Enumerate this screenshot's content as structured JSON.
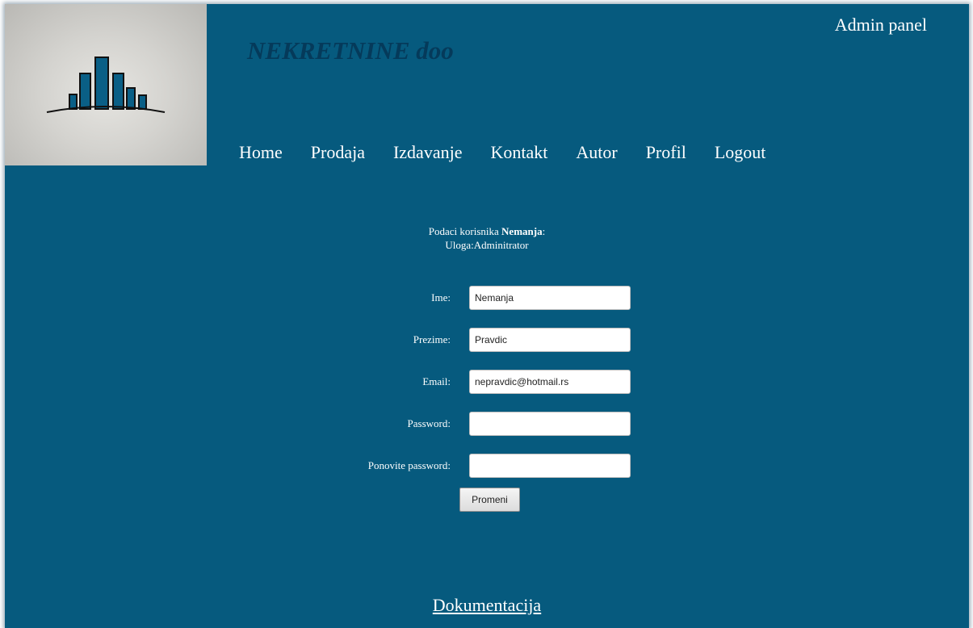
{
  "header": {
    "company_name": "NEKRETNINE doo",
    "admin_panel_label": "Admin panel"
  },
  "nav": {
    "items": [
      {
        "label": "Home"
      },
      {
        "label": "Prodaja"
      },
      {
        "label": "Izdavanje"
      },
      {
        "label": "Kontakt"
      },
      {
        "label": "Autor"
      },
      {
        "label": "Profil"
      },
      {
        "label": "Logout"
      }
    ]
  },
  "user_info": {
    "prefix": "Podaci korisnika ",
    "username": "Nemanja",
    "suffix": ":",
    "role_line": "Uloga:Adminitrator"
  },
  "form": {
    "fields": [
      {
        "label": "Ime:",
        "value": "Nemanja",
        "type": "text"
      },
      {
        "label": "Prezime:",
        "value": "Pravdic",
        "type": "text"
      },
      {
        "label": "Email:",
        "value": "nepravdic@hotmail.rs",
        "type": "text"
      },
      {
        "label": "Password:",
        "value": "",
        "type": "password"
      },
      {
        "label": "Ponovite password:",
        "value": "",
        "type": "password"
      }
    ],
    "submit_label": "Promeni"
  },
  "footer": {
    "doc_link_label": "Dokumentacija"
  },
  "colors": {
    "background": "#065a7e",
    "company_name": "#053a5a",
    "logo_box": "#d4d3cf"
  },
  "icons": {
    "logo": "buildings-logo-icon"
  }
}
